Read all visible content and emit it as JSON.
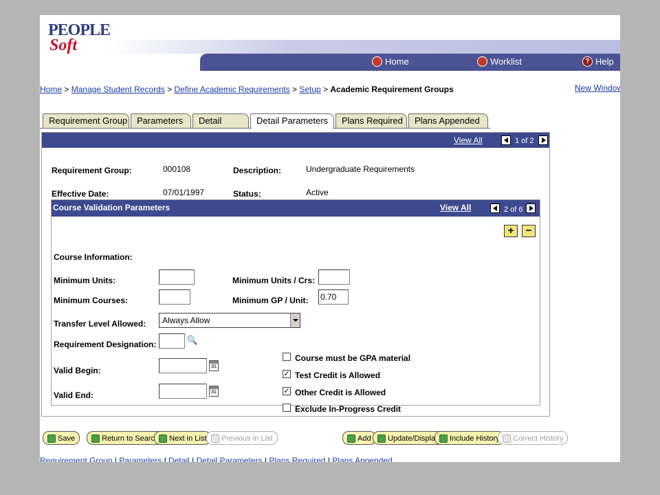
{
  "logo": {
    "top": "PEOPLE",
    "bottom": "Soft"
  },
  "header": {
    "home": "Home",
    "worklist": "Worklist",
    "help": "Help"
  },
  "breadcrumb": {
    "home": "Home",
    "manage": "Manage Student Records",
    "define": "Define Academic Requirements",
    "setup": "Setup",
    "current": "Academic Requirement Groups",
    "sep": ">"
  },
  "new_window": "New Window",
  "tabs": [
    {
      "label": "Requirement Group"
    },
    {
      "label": "Parameters"
    },
    {
      "label": "Detail"
    },
    {
      "label": "Detail Parameters"
    },
    {
      "label": "Plans Required"
    },
    {
      "label": "Plans Appended"
    }
  ],
  "outer": {
    "view_all": "View All",
    "pager": "1 of 2",
    "requirement_group_label": "Requirement Group:",
    "requirement_group_value": "000108",
    "description_label": "Description:",
    "description_value": "Undergraduate Requirements",
    "effective_date_label": "Effective Date:",
    "effective_date_value": "07/01/1997",
    "status_label": "Status:",
    "status_value": "Active"
  },
  "course_validation": {
    "title": "Course Validation Parameters",
    "view_all": "View All",
    "pager": "2 of 6",
    "add_btn": "+",
    "remove_btn": "−",
    "course_info_label": "Course Information:",
    "min_units_label": "Minimum Units:",
    "min_units_value": "",
    "min_units_crs_label": "Minimum Units / Crs:",
    "min_units_crs_value": "",
    "min_courses_label": "Minimum Courses:",
    "min_courses_value": "",
    "min_gp_label": "Minimum GP / Unit:",
    "min_gp_value": "0.70",
    "transfer_label": "Transfer Level Allowed:",
    "transfer_value": "Always Allow",
    "designation_label": "Requirement Designation:",
    "designation_value": "",
    "valid_begin_label": "Valid Begin:",
    "valid_begin_value": "",
    "valid_end_label": "Valid End:",
    "valid_end_value": "",
    "cal_text": "31",
    "checkboxes": [
      {
        "label": "Course must be GPA material",
        "checked": ""
      },
      {
        "label": "Test Credit is Allowed",
        "checked": "✓"
      },
      {
        "label": "Other Credit is Allowed",
        "checked": "✓"
      },
      {
        "label": "Exclude In-Progress Credit",
        "checked": ""
      }
    ]
  },
  "toolbar": {
    "save": "Save",
    "return_to_search": "Return to Search",
    "next_in_list": "Next in List",
    "previous_in_list": "Previous in List",
    "add": "Add",
    "update_display": "Update/Display",
    "include_history": "Include History",
    "correct_history": "Correct History"
  },
  "footer_links": [
    "Requirement Group",
    "Parameters",
    "Detail",
    "Detail Parameters",
    "Plans Required",
    "Plans Appended"
  ],
  "footer_sep": "|"
}
